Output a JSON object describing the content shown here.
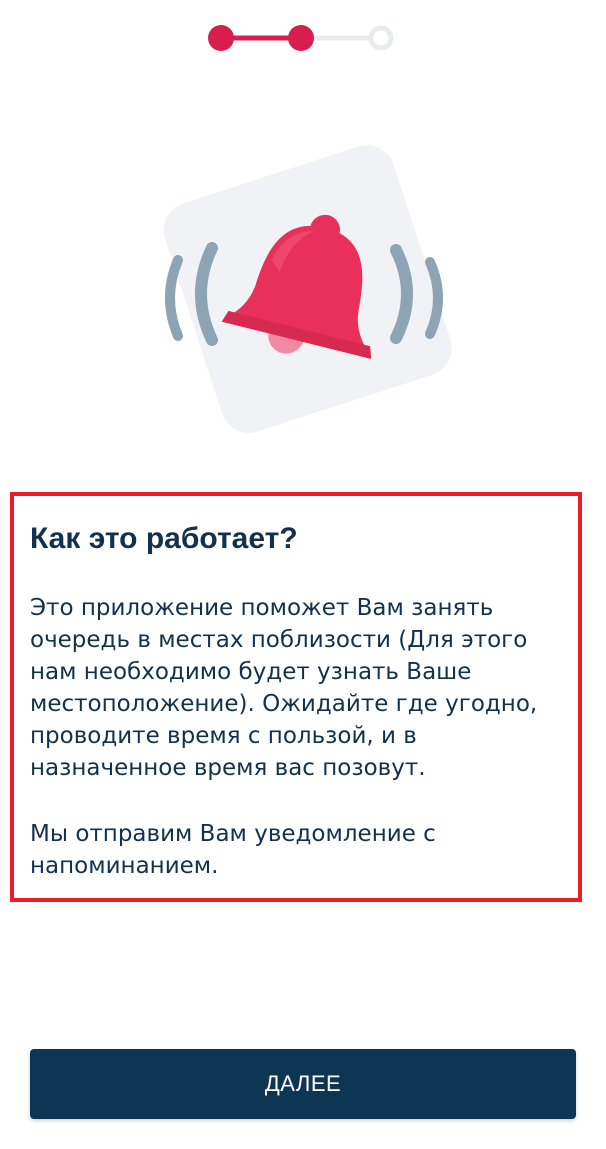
{
  "stepper": {
    "total_steps": 3,
    "current_step": 2,
    "active_color": "#d81e4d",
    "inactive_color": "#e8ecef"
  },
  "illustration": {
    "icon": "ringing-bell-icon",
    "bell_color": "#e8305a",
    "wave_color": "#8da4b4",
    "card_color": "#f0f2f5"
  },
  "info": {
    "title": "Как это работает?",
    "paragraph1": "Это приложение поможет Вам занять очередь в местах поблизости (Для этого нам необходимо будет узнать Ваше местоположение). Ожидайте где угодно, проводите время с пользой, и в назначенное время вас позовут.",
    "paragraph2": "Мы отправим Вам уведомление с напоминанием.",
    "highlight_color": "#ee1c25"
  },
  "footer": {
    "next_label": "ДАЛЕЕ",
    "button_color": "#0d3554"
  }
}
